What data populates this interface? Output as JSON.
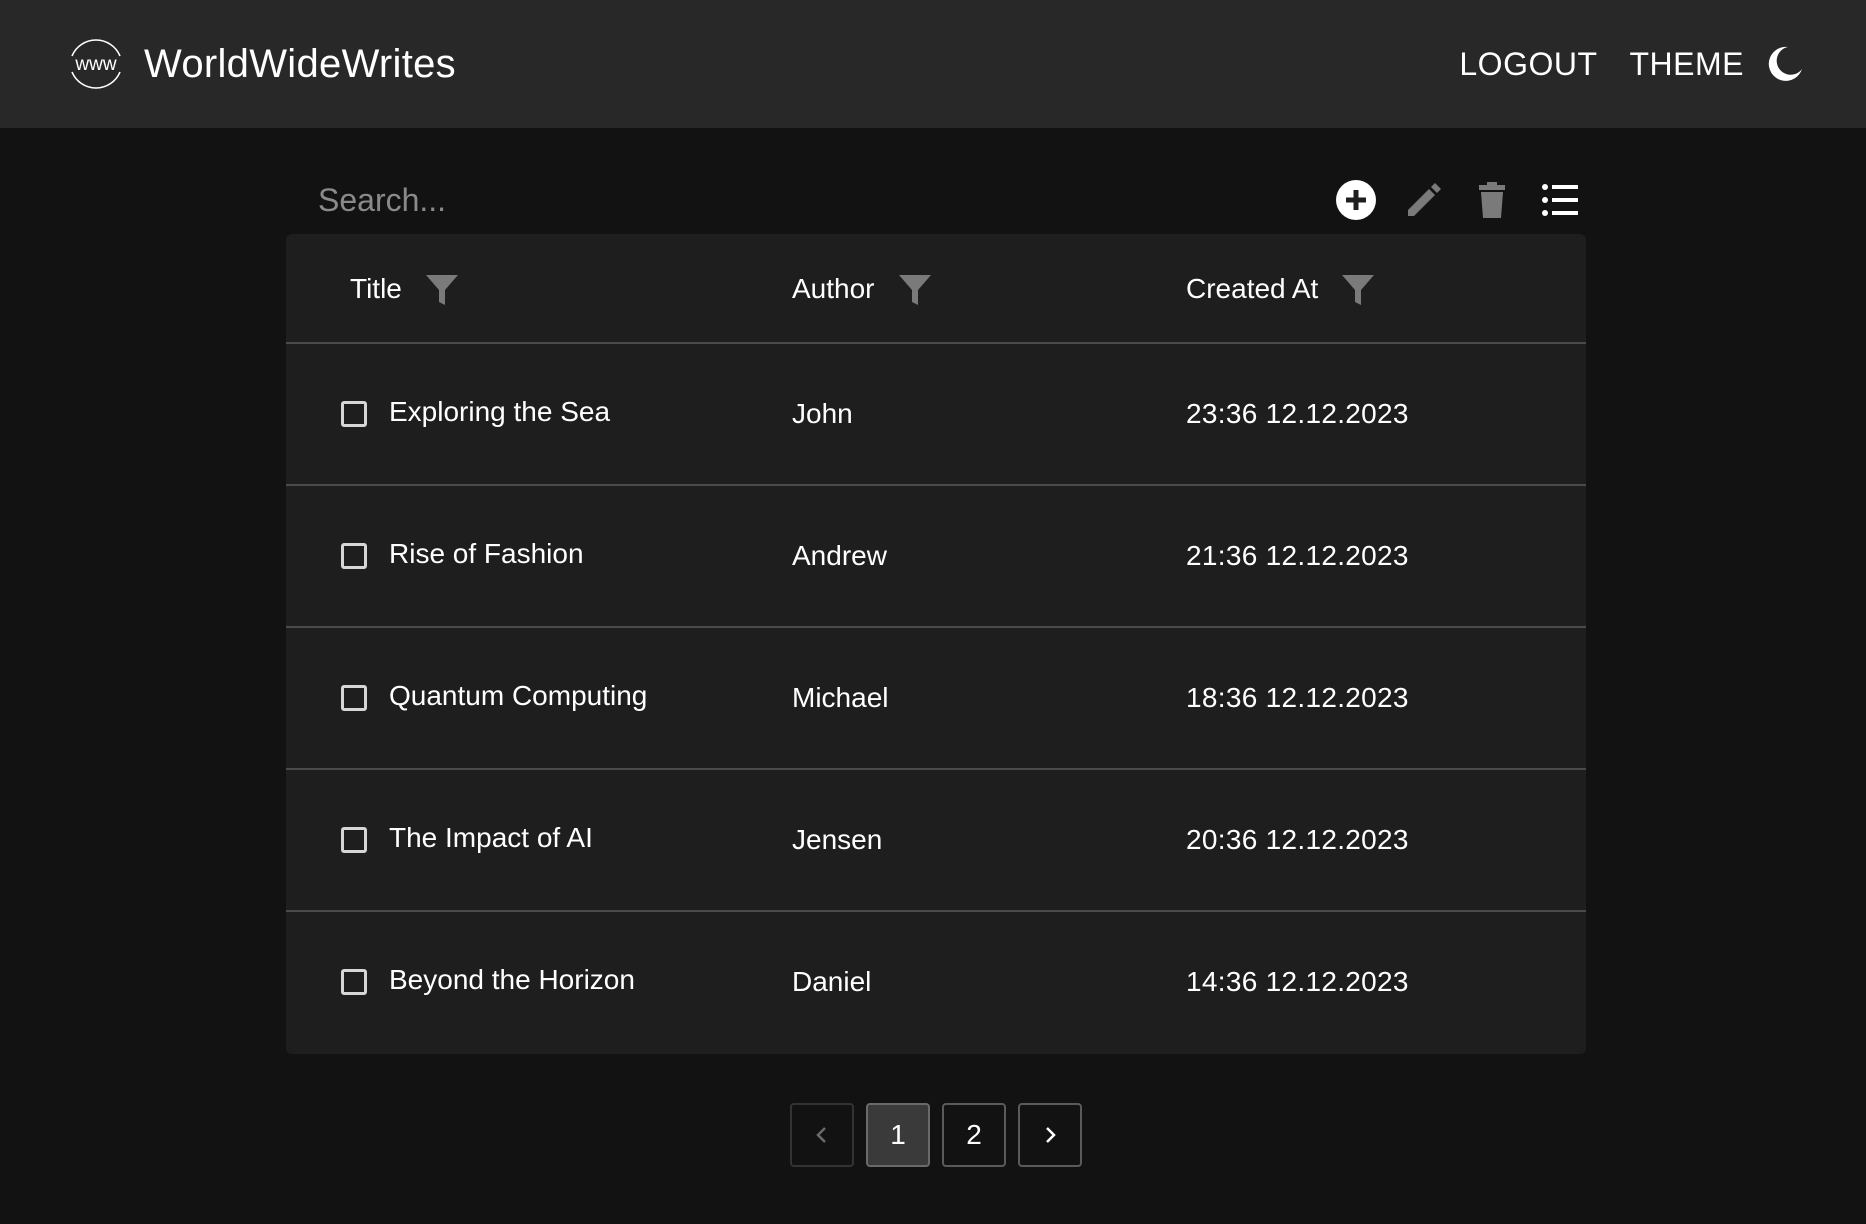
{
  "header": {
    "logo_text": "www",
    "brand": "WorldWideWrites",
    "logout_label": "LOGOUT",
    "theme_label": "THEME"
  },
  "toolbar": {
    "search_placeholder": "Search...",
    "icons": [
      "add-icon",
      "edit-icon",
      "delete-icon",
      "list-view-icon"
    ]
  },
  "table": {
    "columns": [
      "Title",
      "Author",
      "Created At"
    ],
    "rows": [
      {
        "title": "Exploring the Sea",
        "author": "John",
        "created_at": "23:36 12.12.2023",
        "checked": false
      },
      {
        "title": "Rise of Fashion",
        "author": "Andrew",
        "created_at": "21:36 12.12.2023",
        "checked": false
      },
      {
        "title": "Quantum Computing",
        "author": "Michael",
        "created_at": "18:36 12.12.2023",
        "checked": false
      },
      {
        "title": "The Impact of AI",
        "author": "Jensen",
        "created_at": "20:36 12.12.2023",
        "checked": false
      },
      {
        "title": "Beyond the Horizon",
        "author": "Daniel",
        "created_at": "14:36 12.12.2023",
        "checked": false
      }
    ]
  },
  "pagination": {
    "pages": [
      "1",
      "2"
    ],
    "current": "1"
  },
  "colors": {
    "background": "#121212",
    "appbar": "#282828",
    "card": "#1e1e1e",
    "muted_icon": "#7a7a7a",
    "text": "#ffffff"
  }
}
